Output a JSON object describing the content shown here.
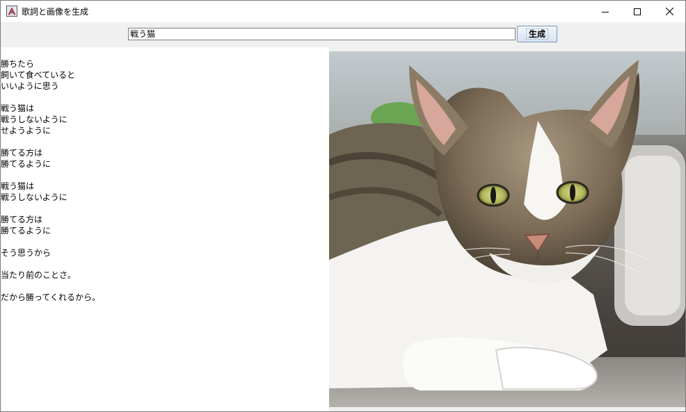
{
  "window": {
    "title": "歌詞と画像を生成"
  },
  "toolbar": {
    "prompt_value": "戦う猫",
    "generate_label": "生成"
  },
  "lyrics": [
    "勝ちたら",
    "飼いて食べていると",
    "いいように思う",
    "",
    "戦う猫は",
    "戦うしないように",
    "せようように",
    "",
    "勝てる方は",
    "勝てるように",
    "",
    "戦う猫は",
    "戦うしないように",
    "",
    "勝てる方は",
    "勝てるように",
    "",
    "そう思うから",
    "",
    "当たり前のことさ。",
    "",
    "だから勝ってくれるから。"
  ],
  "image": {
    "subject": "tabby-white-cat-photo"
  }
}
